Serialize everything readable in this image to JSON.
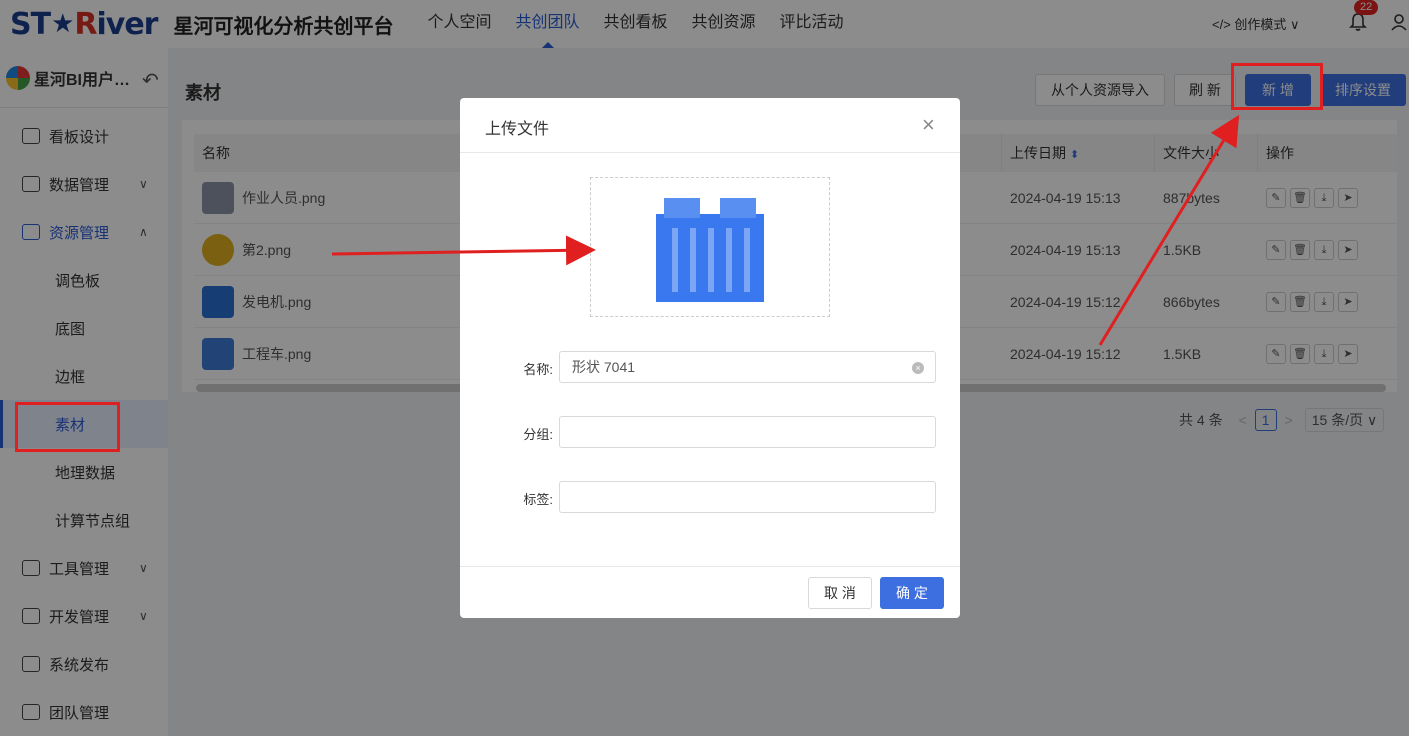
{
  "header": {
    "logo_text_a": "ST",
    "logo_star": "★",
    "logo_text_r": "R",
    "logo_text_b": "iver",
    "platform_title": "星河可视化分析共创平台",
    "nav": [
      "个人空间",
      "共创团队",
      "共创看板",
      "共创资源",
      "评比活动"
    ],
    "mode_label": "</> 创作模式 ∨",
    "notification_count": "22"
  },
  "sidebar": {
    "team_name": "星河BI用户…",
    "back_symbol": "↶",
    "items": [
      {
        "label": "看板设计"
      },
      {
        "label": "数据管理",
        "chev": "∨"
      },
      {
        "label": "资源管理",
        "chev": "∧"
      },
      {
        "label": "工具管理",
        "chev": "∨"
      },
      {
        "label": "开发管理",
        "chev": "∨"
      },
      {
        "label": "系统发布"
      },
      {
        "label": "团队管理"
      }
    ],
    "subitems": [
      "调色板",
      "底图",
      "边框",
      "素材",
      "地理数据",
      "计算节点组"
    ]
  },
  "main": {
    "page_title": "素材",
    "buttons": {
      "import": "从个人资源导入",
      "refresh": "刷 新",
      "add": "新 增",
      "sort": "排序设置"
    },
    "table": {
      "columns": [
        "名称",
        "上传日期",
        "文件大小",
        "操作"
      ],
      "date_sort": "⬍",
      "rows": [
        {
          "name": "作业人员.png",
          "date": "2024-04-19 15:13",
          "size": "887bytes"
        },
        {
          "name": "第2.png",
          "date": "2024-04-19 15:13",
          "size": "1.5KB"
        },
        {
          "name": "发电机.png",
          "date": "2024-04-19 15:12",
          "size": "866bytes"
        },
        {
          "name": "工程车.png",
          "date": "2024-04-19 15:12",
          "size": "1.5KB"
        }
      ],
      "ops": [
        "✎",
        "🗑",
        "⤓",
        "➤"
      ]
    },
    "pager": {
      "total": "共 4 条",
      "prev": "<",
      "current": "1",
      "next": ">",
      "page_size": "15 条/页 ∨"
    }
  },
  "modal": {
    "title": "上传文件",
    "close": "×",
    "fields": {
      "name_label": "名称:",
      "name_value": "形状 7041",
      "group_label": "分组:",
      "tag_label": "标签:"
    },
    "cancel": "取 消",
    "confirm": "确 定"
  },
  "colors": {
    "accent": "#3d6fe0",
    "annotation": "#e02020"
  }
}
